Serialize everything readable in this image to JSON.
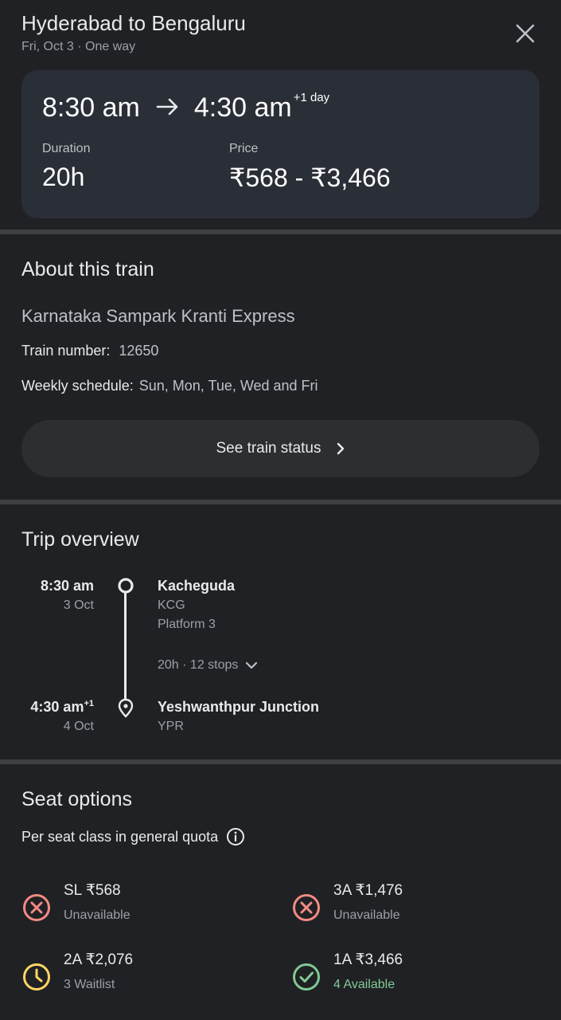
{
  "header": {
    "title": "Hyderabad to Bengaluru",
    "subtitle": "Fri, Oct 3 · One way"
  },
  "summary": {
    "depart": "8:30 am",
    "arrive": "4:30 am",
    "plus_day": "+1 day",
    "duration_label": "Duration",
    "duration": "20h",
    "price_label": "Price",
    "price": "₹568 - ₹3,466"
  },
  "about": {
    "title": "About this train",
    "name": "Karnataka Sampark Kranti Express",
    "number_label": "Train number:",
    "number": "12650",
    "schedule_label": "Weekly schedule:",
    "schedule": "Sun, Mon, Tue, Wed and Fri",
    "status_button": "See train status"
  },
  "trip": {
    "title": "Trip overview",
    "origin": {
      "time": "8:30 am",
      "date": "3 Oct",
      "station": "Kacheguda",
      "code": "KCG",
      "platform": "Platform 3"
    },
    "summary": "20h · 12 stops",
    "destination": {
      "time": "4:30 am",
      "plus": "+1",
      "date": "4 Oct",
      "station": "Yeshwanthpur Junction",
      "code": "YPR"
    }
  },
  "seats": {
    "title": "Seat options",
    "quota": "Per seat class in general quota",
    "options": [
      {
        "name": "SL ₹568",
        "status": "Unavailable",
        "icon": "x-circle-icon",
        "color": "#f28b82"
      },
      {
        "name": "3A ₹1,476",
        "status": "Unavailable",
        "icon": "x-circle-icon",
        "color": "#f28b82"
      },
      {
        "name": "2A ₹2,076",
        "status": "3 Waitlist",
        "icon": "clock-icon",
        "color": "#fdd663"
      },
      {
        "name": "1A ₹3,466",
        "status": "4 Available",
        "icon": "check-circle-icon",
        "color": "#81c995"
      }
    ]
  },
  "colors": {
    "background": "#202124",
    "card": "#2a2e37",
    "available": "#81c995",
    "unavailable": "#f28b82",
    "waitlist": "#fdd663"
  }
}
